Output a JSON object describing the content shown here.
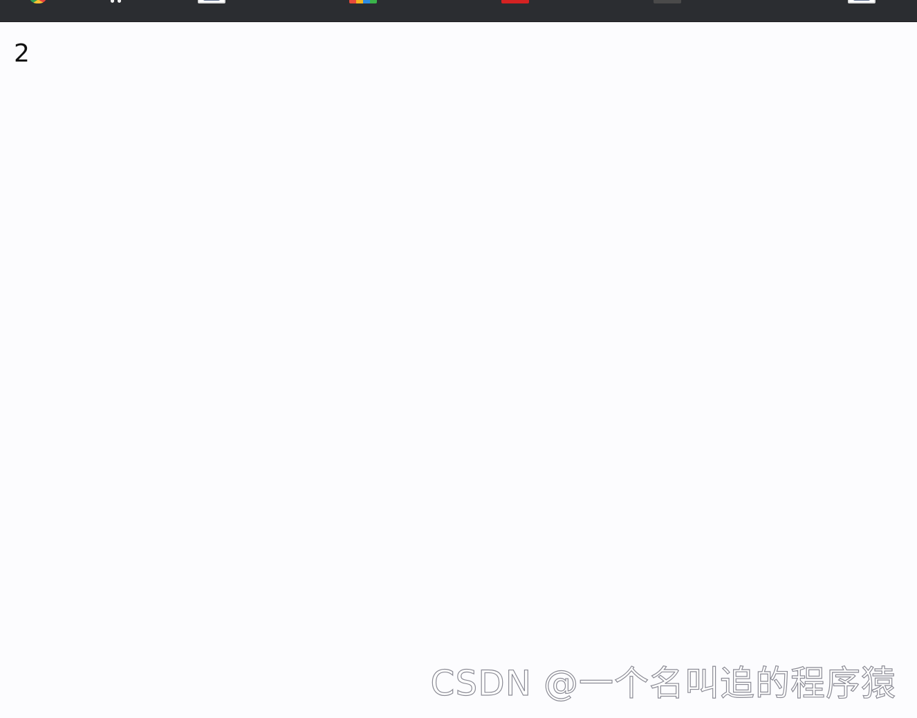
{
  "taskbar": {
    "icons": [
      "chrome-icon",
      "app-glyph-icon",
      "window-icon",
      "palette-icon",
      "red-app-icon",
      "dark-app-icon",
      "window-icon"
    ],
    "background_color": "#2b2d31"
  },
  "content": {
    "number": "2"
  },
  "watermark": {
    "text": "CSDN @一个名叫追的程序猿"
  }
}
